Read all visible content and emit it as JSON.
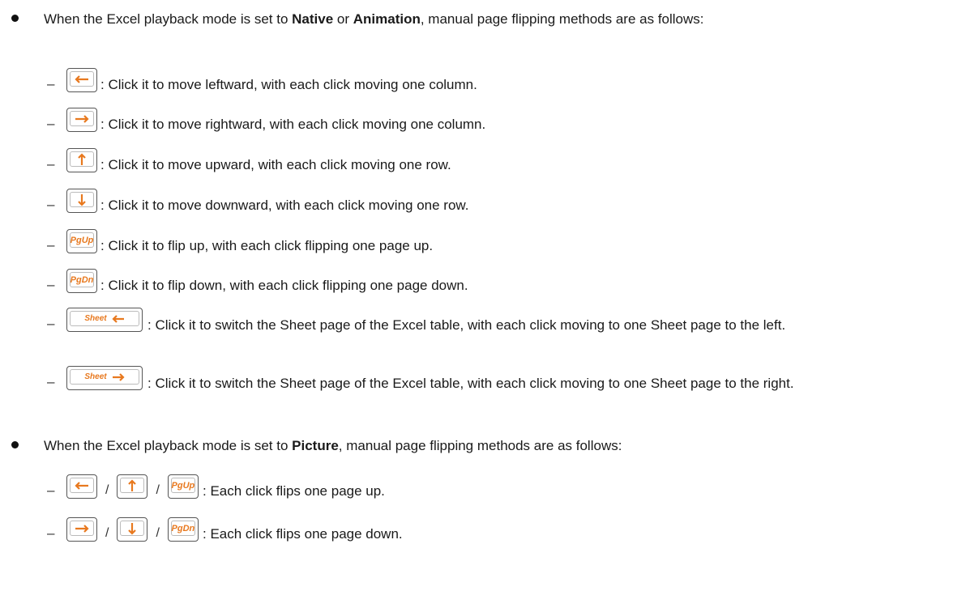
{
  "bullets": [
    {
      "pre": "When the Excel playback mode is set to ",
      "b1": "Native",
      "mid": " or ",
      "b2": "Animation",
      "post": ", manual page flipping methods are as follows:"
    },
    {
      "pre": "When the Excel playback mode is set to ",
      "b1": "Picture",
      "post": ", manual page flipping methods are as follows:"
    }
  ],
  "dash": "–",
  "separator": "/",
  "keys": {
    "pgup": "PgUp",
    "pgdn": "PgDn",
    "sheet": "Sheet"
  },
  "icons": {
    "left": "left-arrow-icon",
    "right": "right-arrow-icon",
    "up": "up-arrow-icon",
    "down": "down-arrow-icon"
  },
  "items": {
    "left": ": Click it to move leftward, with each click moving one column.",
    "right": ": Click it to move rightward, with each click moving one column.",
    "up": ": Click it to move upward, with each click moving one row.",
    "down": ": Click it to move downward, with each click moving one row.",
    "pgup": ": Click it to flip up, with each click flipping one page up.",
    "pgdn": ": Click it to flip down, with each click flipping one page down.",
    "sheet_left": ": Click it to switch the Sheet page of the Excel table, with each click moving to one Sheet page to the left.",
    "sheet_right": ": Click it to switch the Sheet page of the Excel table, with each click moving to one Sheet page to the right.",
    "picture_up": ": Each click flips one page up.",
    "picture_down": ": Each click flips one page down."
  },
  "colors": {
    "accent": "#e8791f",
    "text": "#1a1a1a",
    "key_border": "#555555"
  }
}
